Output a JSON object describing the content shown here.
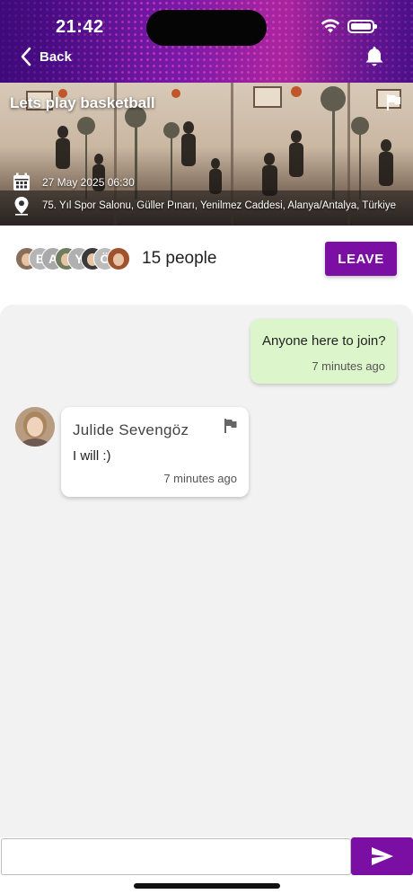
{
  "status_bar": {
    "time": "21:42"
  },
  "header": {
    "back_label": "Back",
    "icons": [
      "chevron-left-icon",
      "bell-icon"
    ]
  },
  "event": {
    "title": "Lets play basketball",
    "date": "27 May 2025 06:30",
    "location": "75. Yıl Spor Salonu, Güller Pınarı, Yenilmez Caddesi, Alanya/Antalya, Türkiye"
  },
  "participants": {
    "avatars": [
      {
        "kind": "photo",
        "color": "#8a6e5a"
      },
      {
        "kind": "letter",
        "letter": "E",
        "color": "#b5b5b5"
      },
      {
        "kind": "letter",
        "letter": "A",
        "color": "#a9a9a9"
      },
      {
        "kind": "photo",
        "color": "#6f7d5e"
      },
      {
        "kind": "letter",
        "letter": "Y",
        "color": "#b0b0b0"
      },
      {
        "kind": "photo",
        "color": "#3a3a3a"
      },
      {
        "kind": "letter",
        "letter": "Ö",
        "color": "#bcbcbc"
      },
      {
        "kind": "photo",
        "color": "#a0522d"
      }
    ],
    "count_label": "15 people",
    "leave_label": "LEAVE"
  },
  "messages": [
    {
      "direction": "outgoing",
      "text": "Anyone here to join?",
      "time": "7 minutes ago"
    },
    {
      "direction": "incoming",
      "sender": "Julide Sevengöz",
      "text": "I will :)",
      "time": "7 minutes ago"
    }
  ],
  "composer": {
    "placeholder": ""
  },
  "colors": {
    "accent": "#7b0fa3",
    "outgoing_bubble": "#ddf5cb",
    "chat_background": "#f2f2f2"
  }
}
